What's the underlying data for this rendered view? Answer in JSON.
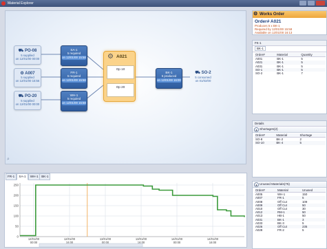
{
  "window": {
    "title": "Material Explorer"
  },
  "canvas": {
    "po08": {
      "title": "PO-08",
      "line1": "5 supplied",
      "line2": "on 12/01/00 00:00"
    },
    "a007": {
      "title": "A007",
      "line1": "5 supplied",
      "line2": "on 12/01/00 15:56"
    },
    "po20": {
      "title": "PO-20",
      "line1": "5 supplied",
      "line2": "on 12/01/00 00:00"
    },
    "sa1": {
      "title": "SA-1",
      "line1": "5 required",
      "line2": "on 12/01/00 15:58"
    },
    "fr1": {
      "title": "FR-1",
      "line1": "5 required",
      "line2": "on 12/01/00 15:58"
    },
    "wh1": {
      "title": "WH-1",
      "line1": "5 required",
      "line2": "on 12/01/00 15:58"
    },
    "a021": {
      "title": "A021",
      "op1": "Op 10",
      "op2": "Op 20"
    },
    "bk1": {
      "title": "BK-1",
      "line1": "5 produced",
      "line2": "on 12/01/00 16:00"
    },
    "so2": {
      "title": "SO-2",
      "line1": "5 consumed",
      "line2": "on 01/02/00"
    }
  },
  "gantt": {
    "tabs": [
      "FR-1",
      "SA-1",
      "WH-1",
      "BK-1"
    ],
    "active_tab": "SA-1"
  },
  "chart_data": {
    "type": "line",
    "title": "",
    "y_ticks": [
      0,
      50,
      100,
      150,
      200,
      250
    ],
    "ylim": [
      0,
      260
    ],
    "x_ticks": [
      "12/01/00\n00:00",
      "12/01/00\n16:00",
      "13/01/00\n00:00",
      "13/01/00\n16:00",
      "14/01/00\n00:00",
      "14/01/00\n16:00"
    ],
    "series": [
      {
        "x": [
          0,
          0.04,
          0.07,
          0.35,
          0.46,
          0.55,
          0.59,
          0.62,
          0.68,
          0.86,
          0.88,
          0.92,
          0.94,
          1.0
        ],
        "values": [
          5,
          5,
          250,
          250,
          250,
          245,
          230,
          225,
          200,
          195,
          130,
          125,
          100,
          95
        ]
      }
    ],
    "cursor_x": 0.3,
    "colors": {
      "line": "#3a9a3a",
      "cursor": "#f0a040",
      "grid": "#d5dbe6"
    }
  },
  "work_order": {
    "header": "Works Order",
    "order": "Order# A021",
    "produces": "Produces 5 x BK-1",
    "required": "Required by 12/01/00 15:58",
    "available": "Available on 12/01/00 16:13"
  },
  "fk_panel": {
    "title": "FK-1",
    "tab": "BK-1",
    "columns": [
      "Order#",
      "Material",
      "Quantity"
    ],
    "rows": [
      [
        "A001",
        "BK-1",
        "5"
      ],
      [
        "A021",
        "BK-1",
        "5"
      ],
      [
        "A031",
        "BK-1",
        "5"
      ],
      [
        "SO-1",
        "BK-1",
        "5"
      ],
      [
        "SO-2",
        "BK-1",
        "7"
      ]
    ]
  },
  "shortages": {
    "panel_title": "Details",
    "header": "Shortages(2)",
    "columns": [
      "Order#",
      "Material",
      "Shortage"
    ],
    "rows": [
      [
        "SO-8",
        "BK-2",
        "2"
      ],
      [
        "SO-10",
        "BK-4",
        "5"
      ]
    ]
  },
  "unused": {
    "header": "Unused Materials(75)",
    "columns": [
      "Order#",
      "Material",
      "Unused"
    ],
    "rows": [
      [
        "A005",
        "WH-1",
        "150"
      ],
      [
        "A007",
        "FR-1",
        "5"
      ],
      [
        "A008",
        "Off Cut",
        "109"
      ],
      [
        "A009",
        "Off Cut",
        "50"
      ],
      [
        "A010",
        "Off Cut",
        "30"
      ],
      [
        "A012",
        "RM-1",
        "50"
      ],
      [
        "A013",
        "HB-1",
        "50"
      ],
      [
        "A031",
        "BK-1",
        "3"
      ],
      [
        "A033",
        "BK-3",
        "5"
      ],
      [
        "A026",
        "Off Cut",
        "235"
      ],
      [
        "A028",
        "FR-2",
        "5"
      ]
    ]
  }
}
